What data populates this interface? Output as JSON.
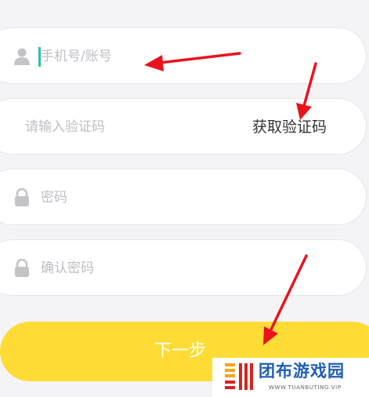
{
  "form": {
    "phone_placeholder": "手机号/账号",
    "code_placeholder": "请输入验证码",
    "get_code_label": "获取验证码",
    "password_placeholder": "密码",
    "confirm_placeholder": "确认密码",
    "next_label": "下一步"
  },
  "icons": {
    "phone_field": "user-icon",
    "password_field": "lock-icon",
    "confirm_field": "lock-icon"
  },
  "watermark": {
    "title": "团布游戏园",
    "subtitle": "WWW.TUANBUTING.VIP"
  },
  "colors": {
    "button": "#ffdc35",
    "annotation_arrow": "#e8141d",
    "cursor": "#29c3a6",
    "watermark_text": "#1e5eb8"
  }
}
